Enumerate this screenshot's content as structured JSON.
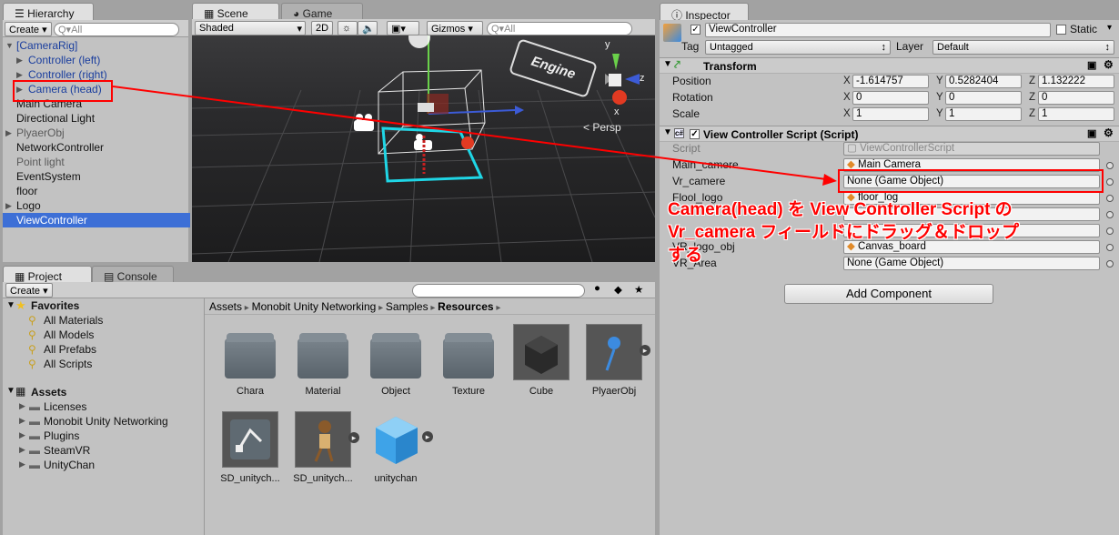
{
  "hierarchy": {
    "tab": "Hierarchy",
    "create": "Create ▾",
    "search": "Q▾All",
    "items": [
      {
        "label": "[CameraRig]",
        "style": "blue"
      },
      {
        "label": "Controller (left)",
        "style": "blue"
      },
      {
        "label": "Controller (right)",
        "style": "blue"
      },
      {
        "label": "Camera (head)",
        "style": "blue"
      },
      {
        "label": "Main Camera",
        "style": ""
      },
      {
        "label": "Directional Light",
        "style": ""
      },
      {
        "label": "PlyaerObj",
        "style": "gray"
      },
      {
        "label": "NetworkController",
        "style": ""
      },
      {
        "label": "Point light",
        "style": "gray"
      },
      {
        "label": "EventSystem",
        "style": ""
      },
      {
        "label": "floor",
        "style": ""
      },
      {
        "label": "Logo",
        "style": ""
      },
      {
        "label": "ViewController",
        "style": "sel"
      }
    ]
  },
  "scene": {
    "tab_scene": "Scene",
    "tab_game": "Game",
    "shaded": "Shaded",
    "mode_2d": "2D",
    "gizmos": "Gizmos ▾",
    "search": "Q▾All",
    "persp": "Persp",
    "axis_y": "y",
    "axis_x": "x",
    "axis_z": "z",
    "logo_text": "Engine"
  },
  "project": {
    "tab_project": "Project",
    "tab_console": "Console",
    "create": "Create ▾",
    "favorites_title": "Favorites",
    "favorites": [
      "All Materials",
      "All Models",
      "All Prefabs",
      "All Scripts"
    ],
    "assets_title": "Assets",
    "assets": [
      "Licenses",
      "Monobit Unity Networking",
      "Plugins",
      "SteamVR",
      "UnityChan"
    ],
    "breadcrumb": [
      "Assets",
      "Monobit Unity Networking",
      "Samples",
      "Resources"
    ],
    "grid": [
      "Chara",
      "Material",
      "Object",
      "Texture",
      "Cube",
      "PlyaerObj",
      "SD_unitych...",
      "SD_unitych...",
      "unitychan"
    ]
  },
  "inspector": {
    "tab": "Inspector",
    "object_name": "ViewController",
    "static": "Static",
    "tag_label": "Tag",
    "tag_value": "Untagged",
    "layer_label": "Layer",
    "layer_value": "Default",
    "transform_title": "Transform",
    "position_label": "Position",
    "rotation_label": "Rotation",
    "scale_label": "Scale",
    "axis_x": "X",
    "axis_y": "Y",
    "axis_z": "Z",
    "pos": [
      "-1.614757",
      "0.5282404",
      "1.132222"
    ],
    "rot": [
      "0",
      "0",
      "0"
    ],
    "scl": [
      "1",
      "1",
      "1"
    ],
    "script_title": "View Controller Script (Script)",
    "fields": [
      {
        "label": "Script",
        "value": "ViewControllerScript"
      },
      {
        "label": "Main_camere",
        "value": "Main Camera"
      },
      {
        "label": "Vr_camere",
        "value": "None (Game Object)"
      },
      {
        "label": "Flool_logo",
        "value": "floor_log"
      },
      {
        "label": "",
        "value": ""
      },
      {
        "label": "",
        "value": ""
      },
      {
        "label": "VR_logo_obj",
        "value": "Canvas_board"
      },
      {
        "label": "VR_Area",
        "value": "None (Game Object)"
      }
    ],
    "add_component": "Add Component"
  },
  "annotation": {
    "line1": "Camera(head) を View Controller Script の",
    "line2": "Vr_camera フィールドにドラッグ＆ドロップする",
    "color": "#ff0000"
  }
}
